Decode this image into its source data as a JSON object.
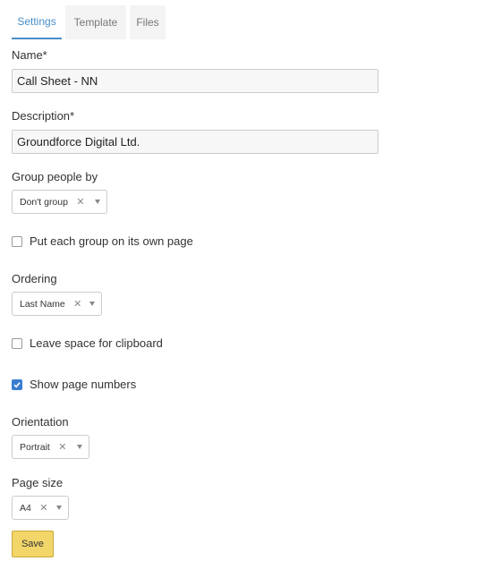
{
  "tabs": [
    {
      "label": "Settings",
      "active": true
    },
    {
      "label": "Template",
      "active": false
    },
    {
      "label": "Files",
      "active": false
    }
  ],
  "form": {
    "name": {
      "label": "Name*",
      "value": "Call Sheet - NN"
    },
    "description": {
      "label": "Description*",
      "value": "Groundforce Digital Ltd."
    },
    "group_people_by": {
      "label": "Group people by",
      "value": "Don't group"
    },
    "own_page_option": {
      "label": "Put each group on its own page",
      "checked": false
    },
    "ordering": {
      "label": "Ordering",
      "value": "Last Name"
    },
    "clipboard_option": {
      "label": "Leave space for clipboard",
      "checked": false
    },
    "page_numbers_option": {
      "label": "Show page numbers",
      "checked": true
    },
    "orientation": {
      "label": "Orientation",
      "value": "Portrait"
    },
    "page_size": {
      "label": "Page size",
      "value": "A4"
    },
    "save_label": "Save"
  },
  "icons": {
    "clear": "close-icon",
    "dropdown": "chevron-down-icon",
    "check": "check-icon"
  },
  "colors": {
    "accent": "#4a8ec8",
    "checkbox_checked": "#3a7dd0",
    "save_button": "#f3d66a"
  }
}
